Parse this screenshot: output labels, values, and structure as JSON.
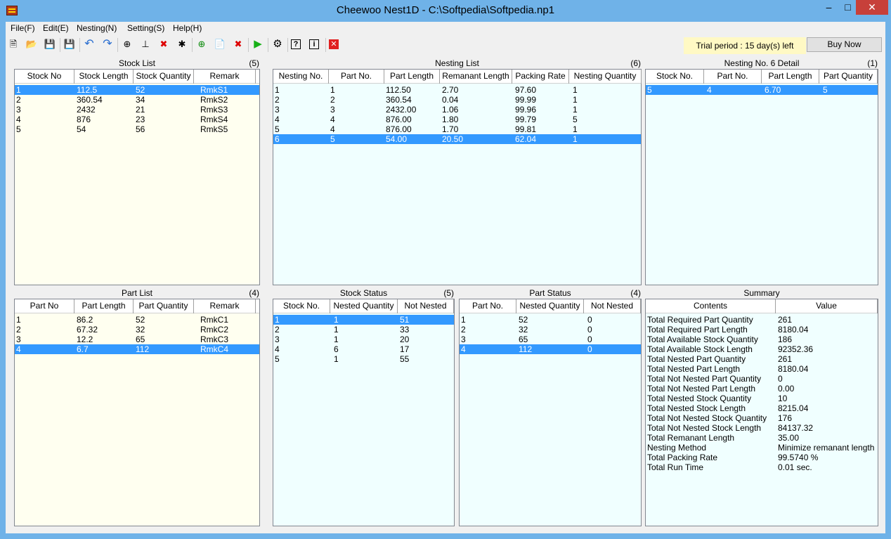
{
  "window": {
    "title": "Cheewoo Nest1D - C:\\Softpedia\\Softpedia.np1"
  },
  "menu": [
    "File(F)",
    "Edit(E)",
    "Nesting(N)",
    "Setting(S)",
    "Help(H)"
  ],
  "toolbar": {
    "trial_text": "Trial period : 15 day(s) left",
    "buy_label": "Buy Now"
  },
  "stock_list": {
    "title": "Stock List",
    "count": "(5)",
    "columns": [
      "Stock No",
      "Stock Length",
      "Stock Quantity",
      "Remark"
    ],
    "rows": [
      [
        "1",
        "112.5",
        "52",
        "RmkS1"
      ],
      [
        "2",
        "360.54",
        "34",
        "RmkS2"
      ],
      [
        "3",
        "2432",
        "21",
        "RmkS3"
      ],
      [
        "4",
        "876",
        "23",
        "RmkS4"
      ],
      [
        "5",
        "54",
        "56",
        "RmkS5"
      ]
    ],
    "selected_row": 0
  },
  "nesting_list": {
    "title": "Nesting List",
    "count": "(6)",
    "columns": [
      "Nesting No.",
      "Part No.",
      "Part Length",
      "Remanant Length",
      "Packing Rate",
      "Nesting Quantity"
    ],
    "rows": [
      [
        "1",
        "1",
        "112.50",
        "2.70",
        "97.60",
        "1"
      ],
      [
        "2",
        "2",
        "360.54",
        "0.04",
        "99.99",
        "1"
      ],
      [
        "3",
        "3",
        "2432.00",
        "1.06",
        "99.96",
        "1"
      ],
      [
        "4",
        "4",
        "876.00",
        "1.80",
        "99.79",
        "5"
      ],
      [
        "5",
        "4",
        "876.00",
        "1.70",
        "99.81",
        "1"
      ],
      [
        "6",
        "5",
        "54.00",
        "20.50",
        "62.04",
        "1"
      ]
    ],
    "selected_row": 5
  },
  "nesting_detail": {
    "title": "Nesting No. 6 Detail",
    "count": "(1)",
    "columns": [
      "Stock No.",
      "Part No.",
      "Part Length",
      "Part Quantity"
    ],
    "rows": [
      [
        "5",
        "4",
        "6.70",
        "5"
      ]
    ],
    "selected_row": 0
  },
  "part_list": {
    "title": "Part List",
    "count": "(4)",
    "columns": [
      "Part No",
      "Part Length",
      "Part Quantity",
      "Remark"
    ],
    "rows": [
      [
        "1",
        "86.2",
        "52",
        "RmkC1"
      ],
      [
        "2",
        "67.32",
        "32",
        "RmkC2"
      ],
      [
        "3",
        "12.2",
        "65",
        "RmkC3"
      ],
      [
        "4",
        "6.7",
        "112",
        "RmkC4"
      ]
    ],
    "selected_row": 3
  },
  "stock_status": {
    "title": "Stock Status",
    "count": "(5)",
    "columns": [
      "Stock No.",
      "Nested Quantity",
      "Not Nested"
    ],
    "rows": [
      [
        "1",
        "1",
        "51"
      ],
      [
        "2",
        "1",
        "33"
      ],
      [
        "3",
        "1",
        "20"
      ],
      [
        "4",
        "6",
        "17"
      ],
      [
        "5",
        "1",
        "55"
      ]
    ],
    "selected_row": 0
  },
  "part_status": {
    "title": "Part Status",
    "count": "(4)",
    "columns": [
      "Part No.",
      "Nested Quantity",
      "Not Nested"
    ],
    "rows": [
      [
        "1",
        "52",
        "0"
      ],
      [
        "2",
        "32",
        "0"
      ],
      [
        "3",
        "65",
        "0"
      ],
      [
        "4",
        "112",
        "0"
      ]
    ],
    "selected_row": 3
  },
  "summary": {
    "title": "Summary",
    "count": "",
    "columns": [
      "Contents",
      "Value"
    ],
    "rows": [
      [
        "Total Required Part Quantity",
        "261"
      ],
      [
        "Total Required Part Length",
        "8180.04"
      ],
      [
        "Total Available Stock Quantity",
        "186"
      ],
      [
        "Total Available Stock Length",
        "92352.36"
      ],
      [
        "Total Nested Part Quantity",
        "261"
      ],
      [
        "Total Nested Part Length",
        "8180.04"
      ],
      [
        "Total Not Nested Part Quantity",
        "0"
      ],
      [
        "Total Not Nested Part Length",
        "0.00"
      ],
      [
        "Total Nested Stock Quantity",
        "10"
      ],
      [
        "Total Nested Stock Length",
        "8215.04"
      ],
      [
        "Total Not Nested Stock Quantity",
        "176"
      ],
      [
        "Total Not Nested Stock Length",
        "84137.32"
      ],
      [
        "Total Remanant Length",
        "35.00"
      ],
      [
        "Nesting Method",
        "Minimize remanant length"
      ],
      [
        "Total Packing Rate",
        "99.5740 %"
      ],
      [
        "Total Run Time",
        "0.01 sec."
      ]
    ],
    "selected_row": -1
  }
}
